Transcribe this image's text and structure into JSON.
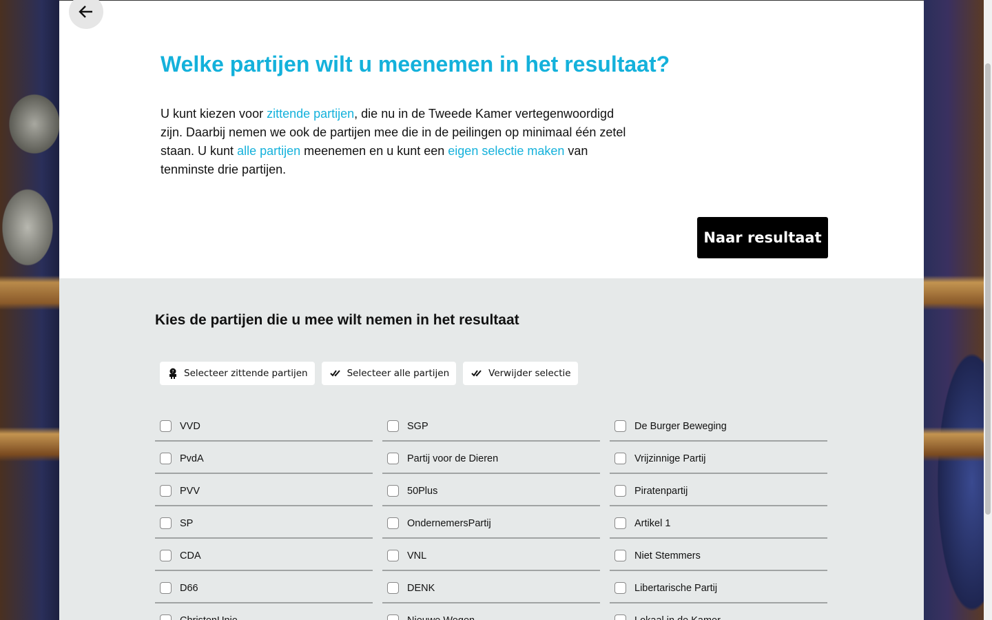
{
  "header": {
    "back_label": "Terug"
  },
  "title": "Welke partijen wilt u meenemen in het resultaat?",
  "intro": {
    "t1": "U kunt kiezen voor ",
    "l1": "zittende partijen",
    "t2": ", die nu in de Tweede Kamer vertegenwoordigd zijn. Daarbij nemen we ook de partijen mee die in de peilingen op minimaal één zetel staan. U kunt ",
    "l2": "alle partijen",
    "t3": " meenemen en u kunt een ",
    "l3": "eigen selectie maken",
    "t4": " van tenminste drie partijen."
  },
  "cta": "Naar resultaat",
  "selection": {
    "heading": "Kies de partijen die u mee wilt nemen in het resultaat",
    "buttons": [
      {
        "label": "Selecteer zittende partijen",
        "icon": "seated-person-icon"
      },
      {
        "label": "Selecteer alle partijen",
        "icon": "double-check-icon"
      },
      {
        "label": "Verwijder selectie",
        "icon": "double-check-icon"
      }
    ],
    "parties": [
      "VVD",
      "SGP",
      "De Burger Beweging",
      "PvdA",
      "Partij voor de Dieren",
      "Vrijzinnige Partij",
      "PVV",
      "50Plus",
      "Piratenpartij",
      "SP",
      "OndernemersPartij",
      "Artikel 1",
      "CDA",
      "VNL",
      "Niet Stemmers",
      "D66",
      "DENK",
      "Libertarische Partij",
      "ChristenUnie",
      "Nieuwe Wegen",
      "Lokaal in de Kamer"
    ]
  }
}
